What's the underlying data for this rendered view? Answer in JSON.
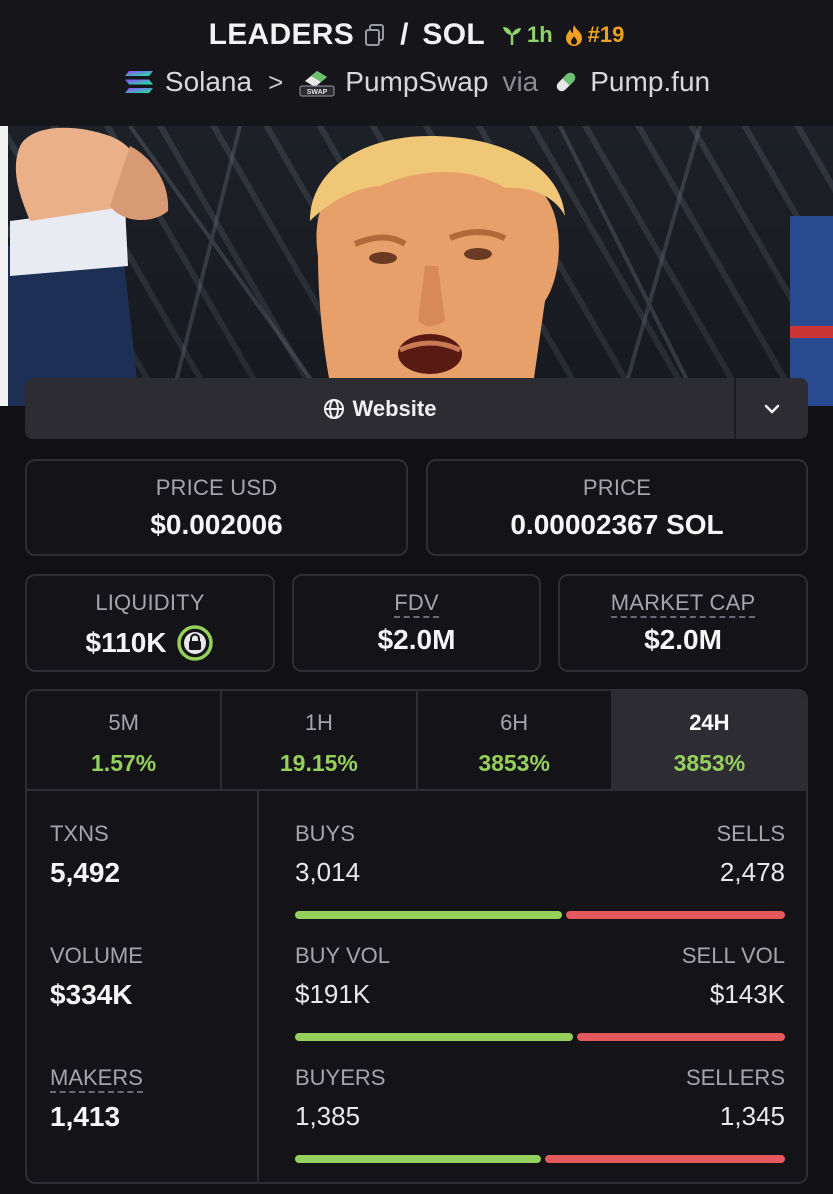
{
  "header": {
    "title": "LEADERS",
    "quote": "SOL",
    "age": "1h",
    "rank": "#19",
    "chain": "Solana",
    "dex": "PumpSwap",
    "via": "via",
    "launchpad": "Pump.fun",
    "dex_badge": "SWAP",
    "colors": {
      "age": "#8fd36a",
      "rank": "#f0a020"
    }
  },
  "website": {
    "label": "Website"
  },
  "price_usd": {
    "label": "PRICE USD",
    "value": "$0.002006"
  },
  "price": {
    "label": "PRICE",
    "value": "0.00002367 SOL"
  },
  "liquidity": {
    "label": "LIQUIDITY",
    "value": "$110K"
  },
  "fdv": {
    "label": "FDV",
    "value": "$2.0M"
  },
  "market_cap": {
    "label": "MARKET CAP",
    "value": "$2.0M"
  },
  "timeframes": [
    {
      "label": "5M",
      "change": "1.57%"
    },
    {
      "label": "1H",
      "change": "19.15%"
    },
    {
      "label": "6H",
      "change": "3853%"
    },
    {
      "label": "24H",
      "change": "3853%",
      "active": true
    }
  ],
  "stats": {
    "txns": {
      "label": "TXNS",
      "value": "5,492"
    },
    "volume": {
      "label": "VOLUME",
      "value": "$334K"
    },
    "makers": {
      "label": "MAKERS",
      "value": "1,413"
    }
  },
  "splits": {
    "buys": {
      "label": "BUYS",
      "value": "3,014"
    },
    "sells": {
      "label": "SELLS",
      "value": "2,478"
    },
    "buy_vol": {
      "label": "BUY VOL",
      "value": "$191K"
    },
    "sell_vol": {
      "label": "SELL VOL",
      "value": "$143K"
    },
    "buyers": {
      "label": "BUYERS",
      "value": "1,385"
    },
    "sellers": {
      "label": "SELLERS",
      "value": "1,345"
    },
    "buy_share": {
      "txns": 0.549,
      "volume": 0.572,
      "makers": 0.507
    },
    "colors": {
      "buy": "#95cf5c",
      "sell": "#e5595c"
    }
  }
}
